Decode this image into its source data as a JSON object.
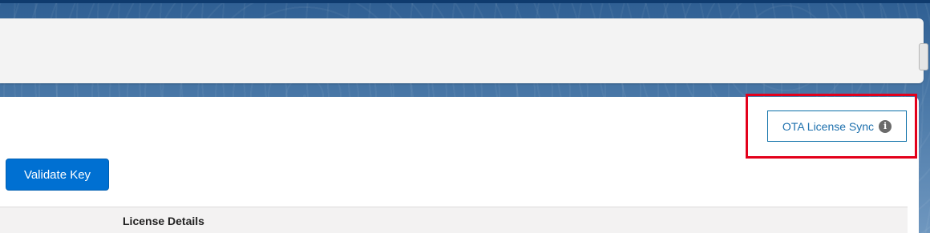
{
  "toolbar": {
    "ota_sync_label": "OTA License Sync",
    "ota_sync_icon": "info-icon",
    "validate_label": "Validate Key"
  },
  "table": {
    "columns": [
      "License Details"
    ]
  },
  "colors": {
    "primary": "#0070d2",
    "highlight": "#e3001b",
    "link": "#1b6fad"
  }
}
